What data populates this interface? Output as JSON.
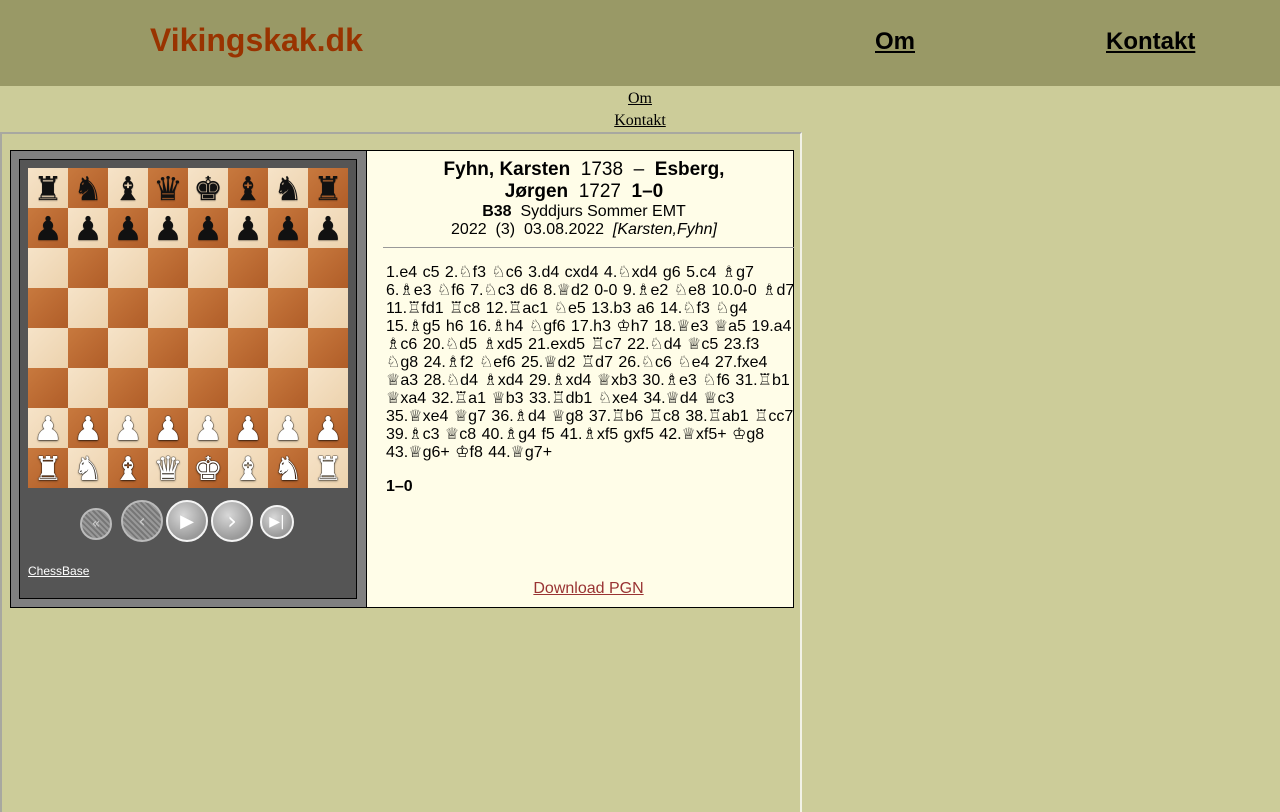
{
  "header": {
    "site_title": "Vikingskak.dk",
    "nav": [
      "Om",
      "Kontakt"
    ]
  },
  "subnav": [
    "Om",
    "Kontakt"
  ],
  "game": {
    "white": "Fyhn, Karsten",
    "white_elo": "1738",
    "separator": "–",
    "black_line1": "Esberg,",
    "black_line2": "Jørgen",
    "black_elo": "1727",
    "result": "1–0",
    "eco": "B38",
    "event": "Syddjurs Sommer EMT",
    "year": "2022",
    "round": "(3)",
    "date": "03.08.2022",
    "annotator": "[Karsten,Fyhn]",
    "moves": "1.e4  c5  2.♘f3  ♘c6  3.d4  cxd4  4.♘xd4  g6  5.c4  ♗g7  6.♗e3  ♘f6  7.♘c3  d6  8.♕d2  0-0  9.♗e2  ♘e8  10.0-0  ♗d7  11.♖fd1  ♖c8  12.♖ac1  ♘e5  13.b3  a6  14.♘f3  ♘g4  15.♗g5  h6  16.♗h4  ♘gf6  17.h3  ♔h7  18.♕e3  ♕a5  19.a4  ♗c6  20.♘d5  ♗xd5  21.exd5  ♖c7  22.♘d4  ♕c5  23.f3  ♘g8  24.♗f2  ♘ef6  25.♕d2  ♖d7  26.♘c6  ♘e4  27.fxe4  ♕a3  28.♘d4  ♗xd4  29.♗xd4  ♕xb3  30.♗e3  ♘f6  31.♖b1  ♕xa4  32.♖a1  ♕b3  33.♖db1  ♘xe4  34.♕d4  ♕c3  35.♕xe4  ♕g7  36.♗d4  ♕g8  37.♖b6  ♖c8  38.♖ab1  ♖cc7  39.♗c3  ♕c8  40.♗g4  f5  41.♗xf5  gxf5  42.♕xf5+  ♔g8  43.♕g6+  ♔f8  44.♕g7+",
    "final_result": "1–0",
    "download_label": "Download PGN"
  },
  "viewer": {
    "brand_link": "ChessBase",
    "controls": [
      {
        "name": "first-move-button",
        "icon": "double-chevron-left-icon",
        "enabled": false
      },
      {
        "name": "prev-move-button",
        "icon": "chevron-left-icon",
        "enabled": false
      },
      {
        "name": "play-button",
        "icon": "play-icon",
        "enabled": true
      },
      {
        "name": "next-move-button",
        "icon": "chevron-right-icon",
        "enabled": true
      },
      {
        "name": "last-move-button",
        "icon": "skip-end-icon",
        "enabled": true
      }
    ],
    "position": [
      [
        "r",
        "n",
        "b",
        "q",
        "k",
        "b",
        "n",
        "r"
      ],
      [
        "p",
        "p",
        "p",
        "p",
        "p",
        "p",
        "p",
        "p"
      ],
      [
        "",
        "",
        "",
        "",
        "",
        "",
        "",
        ""
      ],
      [
        "",
        "",
        "",
        "",
        "",
        "",
        "",
        ""
      ],
      [
        "",
        "",
        "",
        "",
        "",
        "",
        "",
        ""
      ],
      [
        "",
        "",
        "",
        "",
        "",
        "",
        "",
        ""
      ],
      [
        "P",
        "P",
        "P",
        "P",
        "P",
        "P",
        "P",
        "P"
      ],
      [
        "R",
        "N",
        "B",
        "Q",
        "K",
        "B",
        "N",
        "R"
      ]
    ]
  },
  "colors": {
    "page_bg": "#cccc99",
    "header_bg": "#999966",
    "title": "#993300",
    "notation_bg": "#fffde8",
    "viewer_bg": "#555555"
  }
}
